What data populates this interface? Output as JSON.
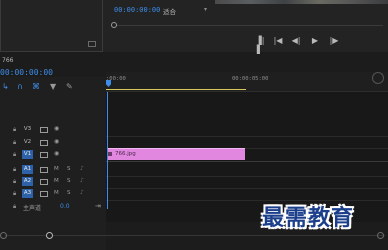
{
  "program_monitor": {
    "timecode": "00:00:00:00",
    "fit_value": "适合",
    "transport": [
      "▐|▌",
      "|◀",
      "◀|",
      "▶",
      "|▶"
    ]
  },
  "sequence": {
    "tab_label": "766",
    "timecode": "00:00:00:00"
  },
  "ruler": {
    "start_label": ":00:00",
    "mid_label": "00:00:05:00"
  },
  "tracks": {
    "video": [
      {
        "name": "V3",
        "active": false
      },
      {
        "name": "V2",
        "active": false
      },
      {
        "name": "V1",
        "active": true
      }
    ],
    "audio": [
      {
        "name": "A1",
        "active": true
      },
      {
        "name": "A2",
        "active": true
      },
      {
        "name": "A3",
        "active": true
      }
    ],
    "mute_label": "M",
    "solo_label": "S"
  },
  "clip": {
    "label": "766.jpg",
    "color": "#e287e0"
  },
  "master": {
    "label": "主声道",
    "value": "0.0"
  },
  "watermark": {
    "text": "最需教育"
  },
  "colors": {
    "accent": "#3d8de8",
    "work_area": "#d7c85a"
  }
}
